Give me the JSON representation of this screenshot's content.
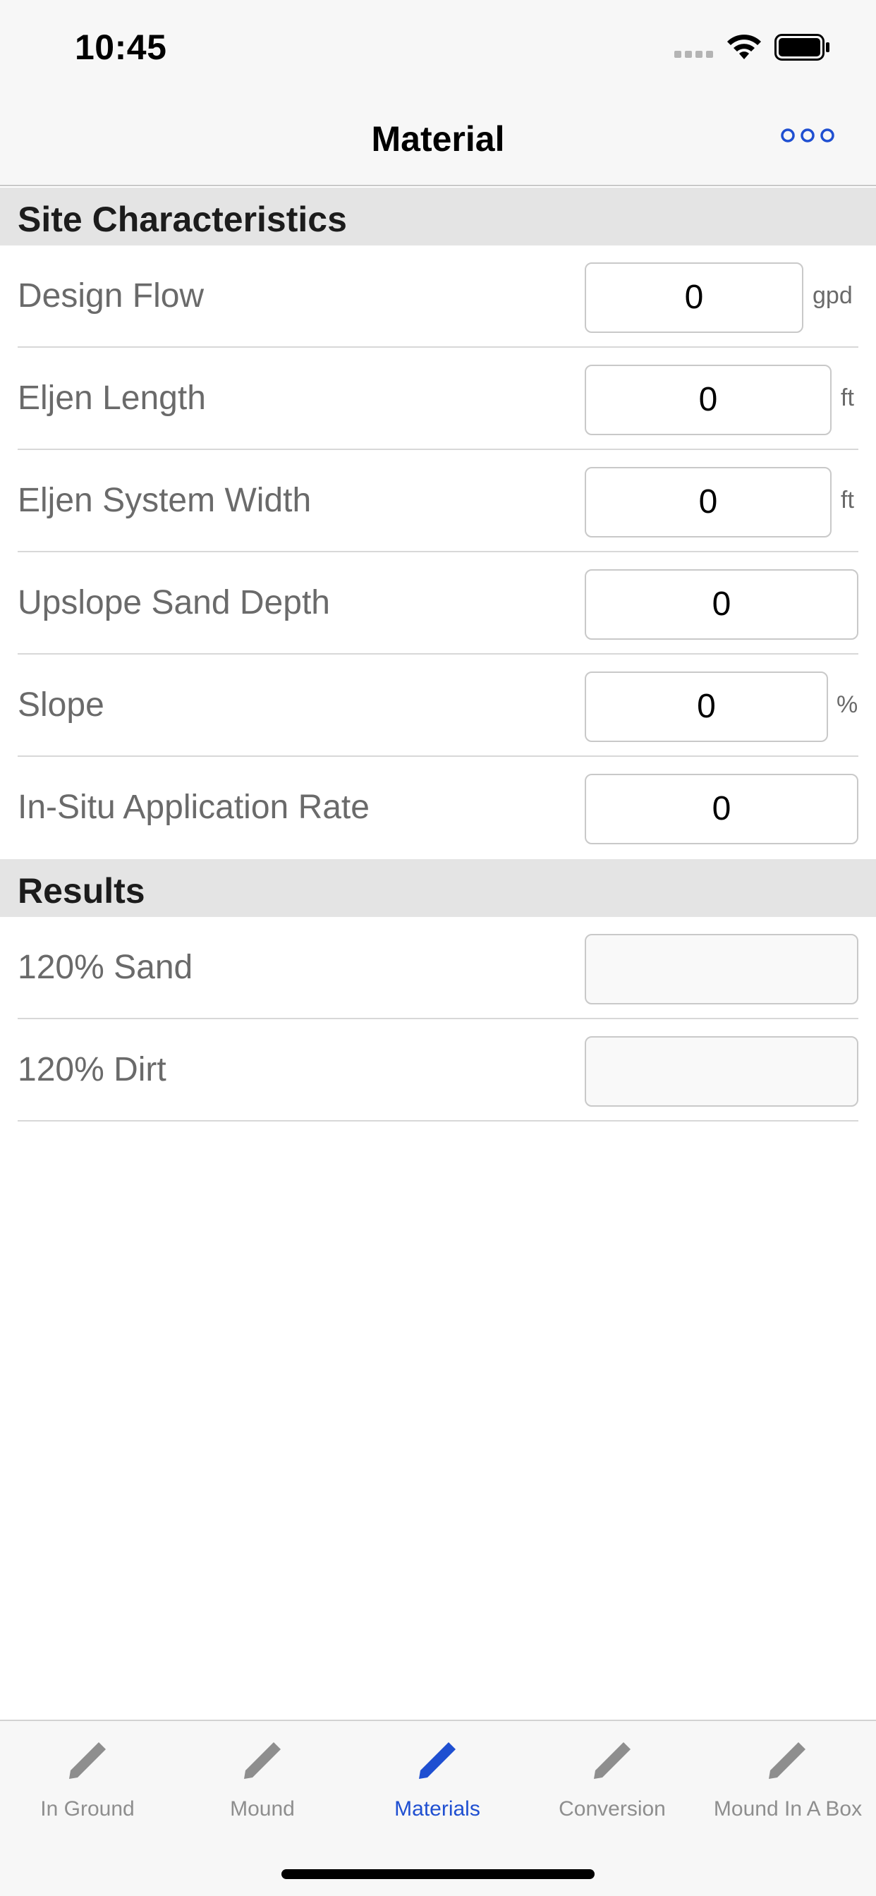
{
  "status": {
    "time": "10:45"
  },
  "nav": {
    "title": "Material"
  },
  "sections": {
    "site": {
      "title": "Site Characteristics"
    },
    "results": {
      "title": "Results"
    }
  },
  "fields": {
    "design_flow": {
      "label": "Design Flow",
      "value": "0",
      "unit": "gpd"
    },
    "eljen_length": {
      "label": "Eljen Length",
      "value": "0",
      "unit": "ft"
    },
    "eljen_width": {
      "label": "Eljen System Width",
      "value": "0",
      "unit": "ft"
    },
    "upslope_depth": {
      "label": "Upslope Sand Depth",
      "value": "0"
    },
    "slope": {
      "label": "Slope",
      "value": "0",
      "unit": "%"
    },
    "application_rate": {
      "label": "In-Situ Application Rate",
      "value": "0"
    }
  },
  "results": {
    "sand": {
      "label": "120% Sand",
      "value": ""
    },
    "dirt": {
      "label": "120% Dirt",
      "value": ""
    }
  },
  "tabs": [
    {
      "label": "In Ground",
      "icon": "pencil-icon",
      "active": false
    },
    {
      "label": "Mound",
      "icon": "pencil-icon",
      "active": false
    },
    {
      "label": "Materials",
      "icon": "pencil-icon",
      "active": true
    },
    {
      "label": "Conversion",
      "icon": "pencil-icon",
      "active": false
    },
    {
      "label": "Mound In A Box",
      "icon": "pencil-icon",
      "active": false
    }
  ],
  "colors": {
    "accent": "#1f4fd1",
    "inactive": "#8e8e8e",
    "section_bg": "#e4e4e4"
  }
}
